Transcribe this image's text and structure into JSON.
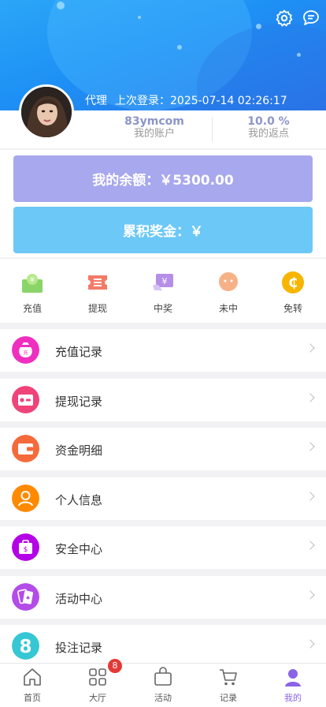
{
  "header": {
    "role": "代理",
    "last_login_label": "上次登录：",
    "last_login_time": "2025-07-14 02:26:17"
  },
  "stats": {
    "account": {
      "value": "83ymcom",
      "label": "我的账户"
    },
    "rebate": {
      "value": "10.0 %",
      "label": "我的返点"
    }
  },
  "balance": {
    "label": "我的余额：",
    "value": "￥5300.00",
    "bonus_label": "累积奖金：",
    "bonus_value": "￥"
  },
  "quick_actions": [
    {
      "label": "充值",
      "icon": "recharge-icon"
    },
    {
      "label": "提现",
      "icon": "withdraw-icon"
    },
    {
      "label": "中奖",
      "icon": "winning-icon"
    },
    {
      "label": "未中",
      "icon": "not-won-icon"
    },
    {
      "label": "免转",
      "icon": "free-transfer-icon"
    }
  ],
  "menu": [
    {
      "label": "充值记录",
      "icon": "money-bag-icon",
      "color": "#ef2fc0"
    },
    {
      "label": "提现记录",
      "icon": "wallet-icon",
      "color": "#f0437a"
    },
    {
      "label": "资金明细",
      "icon": "wallet-detail-icon",
      "color": "#f56a3a"
    },
    {
      "label": "个人信息",
      "icon": "user-icon",
      "color": "#ff8a00"
    },
    {
      "label": "安全中心",
      "icon": "security-icon",
      "color": "#b400e6"
    },
    {
      "label": "活动中心",
      "icon": "cards-icon",
      "color": "#b34ce8"
    },
    {
      "label": "投注记录",
      "icon": "eight-ball-icon",
      "color": "#35c7d3"
    }
  ],
  "tabbar": {
    "items": [
      {
        "label": "首页",
        "icon": "home-icon"
      },
      {
        "label": "大厅",
        "icon": "grid-icon"
      },
      {
        "label": "活动",
        "icon": "bag-icon"
      },
      {
        "label": "记录",
        "icon": "cart-icon"
      },
      {
        "label": "我的",
        "icon": "profile-icon"
      }
    ],
    "badge": "8"
  }
}
